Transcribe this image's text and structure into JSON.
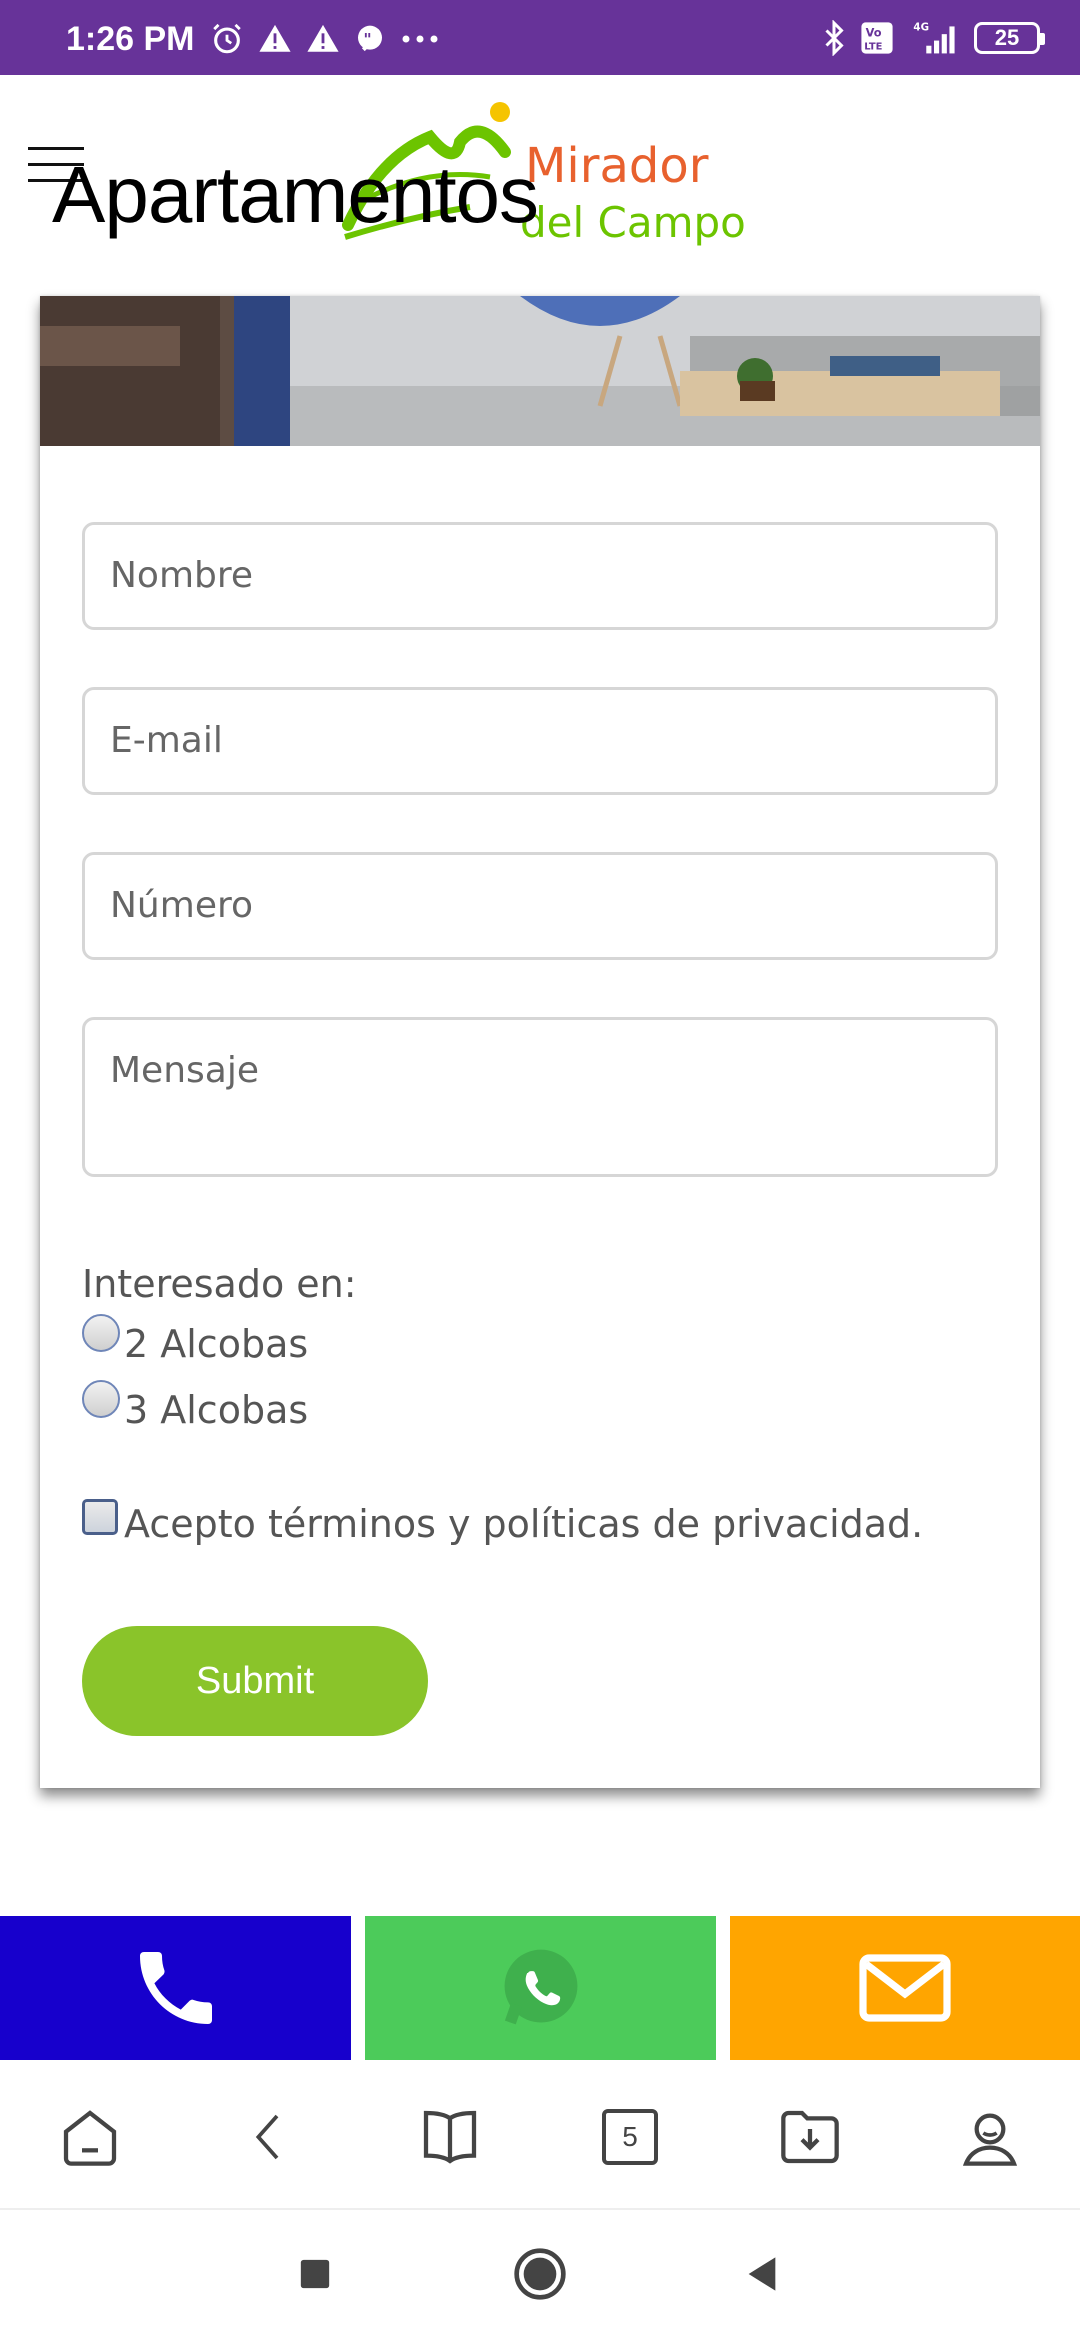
{
  "status_bar": {
    "time": "1:26 PM",
    "battery": "25",
    "network": "4G",
    "volte": "Vo LTE"
  },
  "header": {
    "title": "Apartamentos",
    "logo_line1": "Mirador",
    "logo_line2": "del Campo"
  },
  "form": {
    "name_placeholder": "Nombre",
    "email_placeholder": "E-mail",
    "number_placeholder": "Número",
    "message_placeholder": "Mensaje",
    "interest_label": "Interesado en:",
    "options": [
      "2 Alcobas",
      "3 Alcobas"
    ],
    "terms_label": "Acepto términos y políticas de privacidad.",
    "submit_label": "Submit"
  },
  "contact_bar": {
    "call_color": "#1700cc",
    "whatsapp_color": "#4ccb5a",
    "mail_color": "#ffa500"
  },
  "browser_nav": {
    "tab_count": "5"
  },
  "colors": {
    "status_bar": "#673399",
    "submit": "#8ac42a"
  }
}
